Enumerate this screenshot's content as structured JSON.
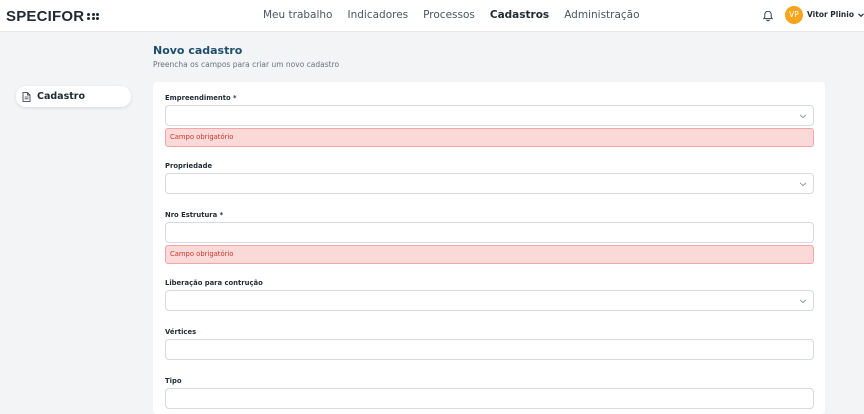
{
  "header": {
    "logo_text": "SPECIFOR",
    "nav": [
      {
        "label": "Meu trabalho"
      },
      {
        "label": "Indicadores"
      },
      {
        "label": "Processos"
      },
      {
        "label": "Cadastros",
        "active": true
      },
      {
        "label": "Administração"
      }
    ],
    "user": {
      "initials": "VP",
      "name": "Vitor Plinio"
    }
  },
  "sidebar": {
    "items": [
      {
        "label": "Cadastro",
        "icon": "document-icon"
      }
    ]
  },
  "page": {
    "title": "Novo cadastro",
    "subtitle": "Preencha os campos para criar um novo cadastro"
  },
  "form": {
    "fields": [
      {
        "label": "Empreendimento *",
        "type": "select",
        "value": "",
        "error": "Campo obrigatório"
      },
      {
        "label": "Propriedade",
        "type": "select",
        "value": ""
      },
      {
        "label": "Nro Estrutura *",
        "type": "text",
        "value": "",
        "error": "Campo obrigatório"
      },
      {
        "label": "Liberação para contrução",
        "type": "select",
        "value": ""
      },
      {
        "label": "Vértices",
        "type": "text",
        "value": ""
      },
      {
        "label": "Tipo",
        "type": "text",
        "value": ""
      }
    ]
  },
  "colors": {
    "accent": "#f7a51c",
    "title": "#1f4e6b",
    "error_bg": "#fbd9d9",
    "error_text": "#c0392b"
  }
}
